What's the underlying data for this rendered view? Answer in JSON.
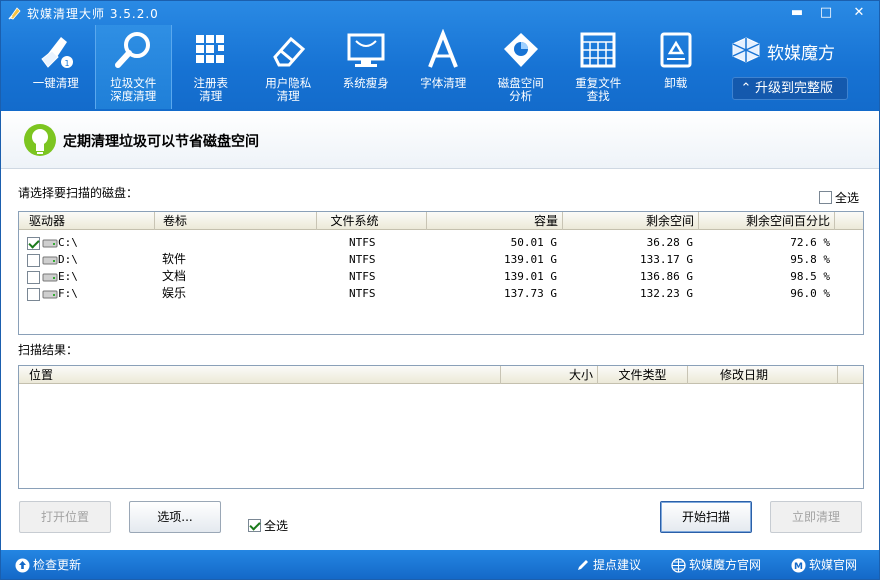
{
  "app": {
    "title": "软媒清理大师 3.5.2.0"
  },
  "window_controls": {
    "minimize": "▬",
    "maximize": "□",
    "close": "✕"
  },
  "toolbar": {
    "items": [
      {
        "label": "一键清理",
        "icon": "broom-icon"
      },
      {
        "label": "垃圾文件\n深度清理",
        "icon": "magnifier-icon",
        "active": true
      },
      {
        "label": "注册表\n清理",
        "icon": "registry-blocks-icon"
      },
      {
        "label": "用户隐私\n清理",
        "icon": "eraser-icon"
      },
      {
        "label": "系统瘦身",
        "icon": "monitor-icon"
      },
      {
        "label": "字体清理",
        "icon": "font-a-icon"
      },
      {
        "label": "磁盘空间\n分析",
        "icon": "disk-pie-icon"
      },
      {
        "label": "重复文件\n查找",
        "icon": "grid-window-icon"
      },
      {
        "label": "卸载",
        "icon": "recycle-icon"
      }
    ]
  },
  "brand": {
    "name": "软媒魔方",
    "upgrade": "升级到完整版"
  },
  "tip": {
    "text": "定期清理垃圾可以节省磁盘空间"
  },
  "disk_section": {
    "label": "请选择要扫描的磁盘：",
    "select_all": "全选",
    "columns": [
      "驱动器",
      "卷标",
      "文件系统",
      "容量",
      "剩余空间",
      "剩余空间百分比"
    ],
    "rows": [
      {
        "checked": true,
        "drive": "C:\\",
        "volume": "",
        "fs": "NTFS",
        "capacity": "50.01 G",
        "free": "36.28 G",
        "percent": "72.6 %"
      },
      {
        "checked": false,
        "drive": "D:\\",
        "volume": "软件",
        "fs": "NTFS",
        "capacity": "139.01 G",
        "free": "133.17 G",
        "percent": "95.8 %"
      },
      {
        "checked": false,
        "drive": "E:\\",
        "volume": "文档",
        "fs": "NTFS",
        "capacity": "139.01 G",
        "free": "136.86 G",
        "percent": "98.5 %"
      },
      {
        "checked": false,
        "drive": "F:\\",
        "volume": "娱乐",
        "fs": "NTFS",
        "capacity": "137.73 G",
        "free": "132.23 G",
        "percent": "96.0 %"
      }
    ]
  },
  "result_section": {
    "label": "扫描结果：",
    "columns": [
      "位置",
      "大小",
      "文件类型",
      "修改日期"
    ]
  },
  "buttons": {
    "open_location": "打开位置",
    "options": "选项...",
    "select_all": "全选",
    "start_scan": "开始扫描",
    "clean_now": "立即清理"
  },
  "statusbar": {
    "check_update": "检查更新",
    "feedback": "提点建议",
    "ruanmei_mofang_site": "软媒魔方官网",
    "ruanmei_site": "软媒官网"
  },
  "colors": {
    "brand_blue": "#1773d4",
    "status_blue": "#1469c8",
    "tip_green": "#7cc520"
  }
}
